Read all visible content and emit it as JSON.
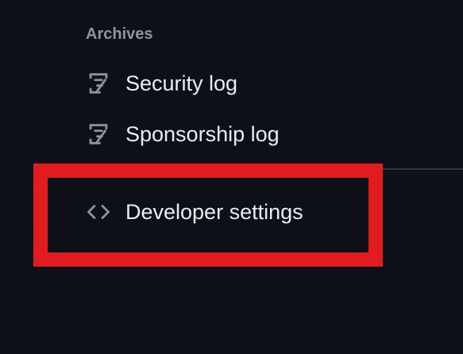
{
  "sidebar": {
    "section_heading": "Archives",
    "items": [
      {
        "label": "Security log",
        "icon": "log-icon"
      },
      {
        "label": "Sponsorship log",
        "icon": "log-icon"
      },
      {
        "label": "Developer settings",
        "icon": "code-icon"
      }
    ]
  },
  "colors": {
    "background": "#0d1117",
    "text": "#e6edf3",
    "muted": "#8b949e",
    "highlight": "#e21b1f",
    "divider": "#30363d"
  }
}
